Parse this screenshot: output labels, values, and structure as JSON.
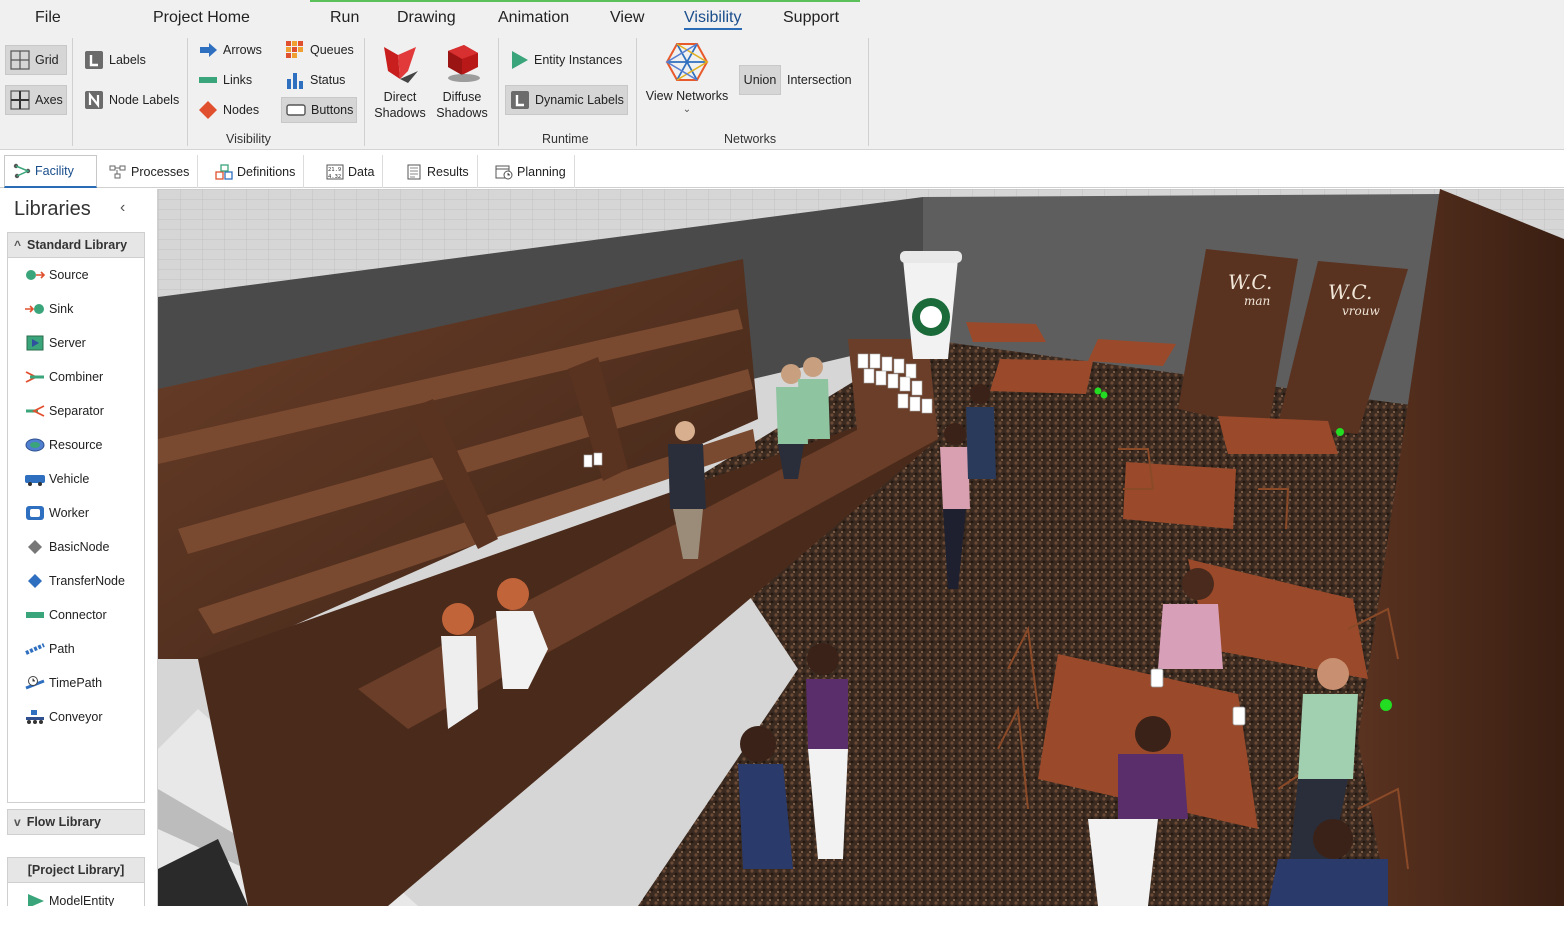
{
  "menu": {
    "items": [
      "File",
      "Project Home",
      "Run",
      "Drawing",
      "Animation",
      "View",
      "Visibility",
      "Support"
    ],
    "active": "Visibility"
  },
  "ribbon": {
    "grid": "Grid",
    "axes": "Axes",
    "labels": "Labels",
    "node_labels": "Node Labels",
    "arrows": "Arrows",
    "links": "Links",
    "nodes": "Nodes",
    "queues": "Queues",
    "status": "Status",
    "buttons": "Buttons",
    "direct_shadows_1": "Direct",
    "direct_shadows_2": "Shadows",
    "diffuse_shadows_1": "Diffuse",
    "diffuse_shadows_2": "Shadows",
    "entity_instances": "Entity Instances",
    "dynamic_labels": "Dynamic Labels",
    "view_networks": "View Networks",
    "union": "Union",
    "intersection": "Intersection",
    "group_visibility": "Visibility",
    "group_runtime": "Runtime",
    "group_networks": "Networks"
  },
  "tabs": [
    "Facility",
    "Processes",
    "Definitions",
    "Data",
    "Results",
    "Planning"
  ],
  "active_tab": "Facility",
  "libraries": {
    "title": "Libraries",
    "standard_header": "Standard Library",
    "items": [
      "Source",
      "Sink",
      "Server",
      "Combiner",
      "Separator",
      "Resource",
      "Vehicle",
      "Worker",
      "BasicNode",
      "TransferNode",
      "Connector",
      "Path",
      "TimePath",
      "Conveyor"
    ],
    "flow_header": "Flow Library",
    "project_header": "[Project Library]",
    "project_items": [
      "ModelEntity"
    ]
  },
  "scene": {
    "sign_left_title": "W.C.",
    "sign_left_sub": "man",
    "sign_right_title": "W.C.",
    "sign_right_sub": "vrouw"
  },
  "colors": {
    "accent_blue": "#2a6bb5",
    "accent_green": "#5cc05a",
    "ribbon_bg": "#f0f0f0",
    "wood": "#5a3422",
    "floor": "#3a2a20"
  }
}
